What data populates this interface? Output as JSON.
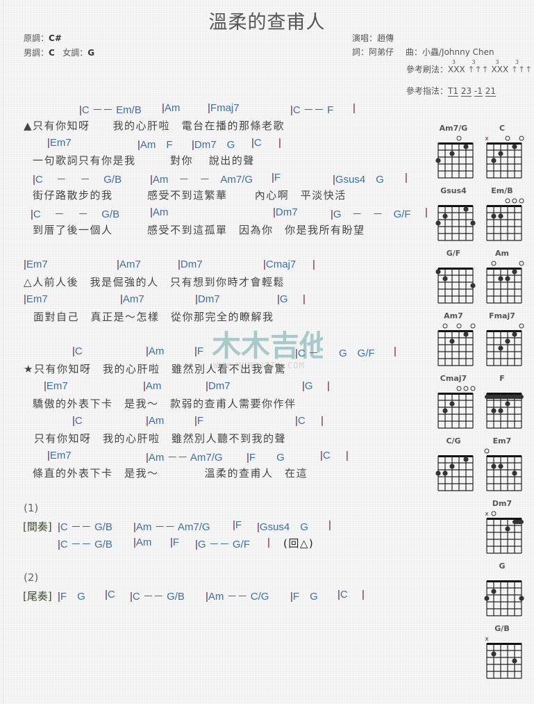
{
  "title": "溫柔的查甫人",
  "key_info": {
    "original_key_label": "原調：",
    "original_key": "C#",
    "male_key_label": "男調：",
    "male_key": "C",
    "female_key_label": "女調：",
    "female_key": "G"
  },
  "credits": {
    "singer": "演唱：趙傳",
    "lyricist": "詞：阿弟仔",
    "composer": "曲：小蟲/Johnny Chen"
  },
  "strumming": {
    "label": "參考刷法：",
    "pattern": [
      "XXX",
      "↑↑↑",
      "XXX",
      "↑↑↑"
    ],
    "triplet_mark": "3"
  },
  "picking": {
    "label": "參考指法：",
    "pattern": [
      "T1",
      "23",
      "-1",
      "21"
    ]
  },
  "verse_a": [
    {
      "chords": [
        "|C －－ Em/B",
        "|Am",
        "|Fmaj7",
        "|C －－ F",
        "|"
      ],
      "lyric": "▲只有你知呀　　我的心肝啦　電台在播的那條老歌"
    },
    {
      "chords": [
        "|Em7",
        "|Am　F",
        "|Dm7　G",
        "|C",
        "|"
      ],
      "lyric": "一句歌詞只有你是我　　　對你　 說出的聲"
    },
    {
      "chords": [
        "|C　 －　 －　 G/B",
        "|Am　－　－　Am7/G",
        "|F",
        "|Gsus4　G",
        "|"
      ],
      "lyric": "街仔路散步的我　　　感受不到這繁華　　 內心啊　平淡快活"
    },
    {
      "chords": [
        "|C　 －　 －　 G/B",
        "|Am",
        "|Dm7",
        "|G　－　－　G/F",
        "|"
      ],
      "lyric": "到厝了後一個人　　　感受不到這孤單　因為你　你是我所有盼望"
    }
  ],
  "verse_b": [
    {
      "chords": [
        "|Em7",
        "|Am7",
        "|Dm7",
        "|Cmaj7",
        "|"
      ],
      "lyric": "△人前人後　我是倔強的人　只有想到你時才會輕鬆"
    },
    {
      "chords": [
        "|Em7",
        "|Am7",
        "|Dm7",
        "|G",
        "|"
      ],
      "lyric": "面對自己　真正是～怎樣　從你那完全的瞭解我"
    }
  ],
  "chorus": [
    {
      "chords": [
        "|C",
        "|Am",
        "|F",
        "|C －",
        "G　G/F",
        "|"
      ],
      "lyric": "★只有你知呀　我的心肝啦　雖然別人看不出我會驚"
    },
    {
      "chords": [
        "|Em7",
        "|Am",
        "|Dm7",
        "|G",
        "|"
      ],
      "lyric": "驕傲的外表下卡　是我～　款弱的查甫人需要你作伴"
    },
    {
      "chords": [
        "|C",
        "|Am",
        "|F",
        "|C",
        "|"
      ],
      "lyric": "只有你知呀　我的心肝啦　雖然別人聽不到我的聲"
    },
    {
      "chords": [
        "|Em7",
        "|Am －－ Am7/G",
        "|F　　G",
        "|C",
        "|"
      ],
      "lyric": "條直的外表下卡　是我～　　　　溫柔的查甫人　在這"
    }
  ],
  "interlude": {
    "section": "(1)",
    "label": "[間奏]",
    "line1": [
      "|C －－ G/B",
      "|Am －－ Am7/G",
      "|F",
      "|Gsus4　G",
      "|"
    ],
    "line2": [
      "|C －－ G/B",
      "|Am",
      "|F",
      "|G －－ G/F",
      "|"
    ],
    "repeat_note": "(回△)"
  },
  "outro": {
    "section": "(2)",
    "label": "[尾奏]",
    "line": [
      "|F　G",
      "|C",
      "|C －－ G/B",
      "|Am －－ C/G",
      "|F　G",
      "|C",
      "|"
    ]
  },
  "chord_diagrams": [
    {
      "name": "Am7/G",
      "top": [
        "",
        "",
        "",
        "o",
        "",
        ""
      ],
      "dots": [
        [
          6,
          3
        ],
        [
          4,
          2
        ],
        [
          2,
          1
        ]
      ],
      "barre": null
    },
    {
      "name": "C",
      "top": [
        "x",
        "",
        "",
        "o",
        "",
        "o"
      ],
      "dots": [
        [
          5,
          3
        ],
        [
          4,
          2
        ],
        [
          2,
          1
        ]
      ],
      "barre": null
    },
    {
      "name": "Gsus4",
      "top": [
        "",
        "",
        "",
        "",
        "",
        ""
      ],
      "dots": [
        [
          6,
          3
        ],
        [
          5,
          2
        ],
        [
          2,
          1
        ],
        [
          1,
          3
        ]
      ],
      "barre": null
    },
    {
      "name": "Em/B",
      "top": [
        "",
        "",
        "",
        "o",
        "o",
        "o"
      ],
      "dots": [
        [
          5,
          2
        ],
        [
          4,
          2
        ]
      ],
      "barre": null
    },
    {
      "name": "G/F",
      "top": [
        "",
        "",
        "",
        "",
        "",
        ""
      ],
      "dots": [
        [
          6,
          1
        ],
        [
          5,
          2
        ],
        [
          1,
          3
        ]
      ],
      "barre": null
    },
    {
      "name": "Am",
      "top": [
        "",
        "o",
        "",
        "",
        "",
        "o"
      ],
      "dots": [
        [
          4,
          2
        ],
        [
          3,
          2
        ],
        [
          2,
          1
        ]
      ],
      "barre": null
    },
    {
      "name": "Am7",
      "top": [
        "",
        "o",
        "",
        "o",
        "",
        "o"
      ],
      "dots": [
        [
          4,
          2
        ],
        [
          2,
          1
        ]
      ],
      "barre": null
    },
    {
      "name": "Fmaj7",
      "top": [
        "",
        "",
        "",
        "",
        "",
        "o"
      ],
      "dots": [
        [
          4,
          3
        ],
        [
          3,
          2
        ],
        [
          2,
          1
        ]
      ],
      "barre": null
    },
    {
      "name": "Cmaj7",
      "top": [
        "",
        "",
        "",
        "o",
        "o",
        "o"
      ],
      "dots": [
        [
          5,
          3
        ],
        [
          4,
          2
        ]
      ],
      "barre": null
    },
    {
      "name": "F",
      "top": [
        "",
        "",
        "",
        "",
        "",
        ""
      ],
      "dots": [
        [
          5,
          3
        ],
        [
          4,
          3
        ],
        [
          3,
          2
        ]
      ],
      "barre": 1
    },
    {
      "name": "C/G",
      "top": [
        "",
        "",
        "",
        "",
        "",
        ""
      ],
      "dots": [
        [
          6,
          3
        ],
        [
          5,
          3
        ],
        [
          4,
          2
        ],
        [
          2,
          1
        ]
      ],
      "barre": null
    },
    {
      "name": "Em7",
      "top": [
        "o",
        "",
        "",
        "",
        "",
        ""
      ],
      "dots": [
        [
          5,
          2
        ],
        [
          4,
          2
        ],
        [
          2,
          3
        ]
      ],
      "barre": null
    },
    {
      "name": "Dm7",
      "top": [
        "x",
        "o",
        "",
        "",
        "",
        ""
      ],
      "dots": [
        [
          3,
          2
        ]
      ],
      "barre": "partial-1"
    },
    {
      "name": "G",
      "top": [
        "",
        "",
        "",
        "",
        "",
        ""
      ],
      "dots": [
        [
          6,
          3
        ],
        [
          5,
          2
        ],
        [
          1,
          3
        ]
      ],
      "barre": null
    },
    {
      "name": "G/B",
      "top": [
        "x",
        "",
        "",
        "",
        "",
        ""
      ],
      "dots": [
        [
          5,
          2
        ],
        [
          2,
          3
        ]
      ],
      "barre": null
    }
  ],
  "watermark": {
    "text": "木木吉他",
    "url_text": "WWW.MUMUJITA.COM"
  }
}
